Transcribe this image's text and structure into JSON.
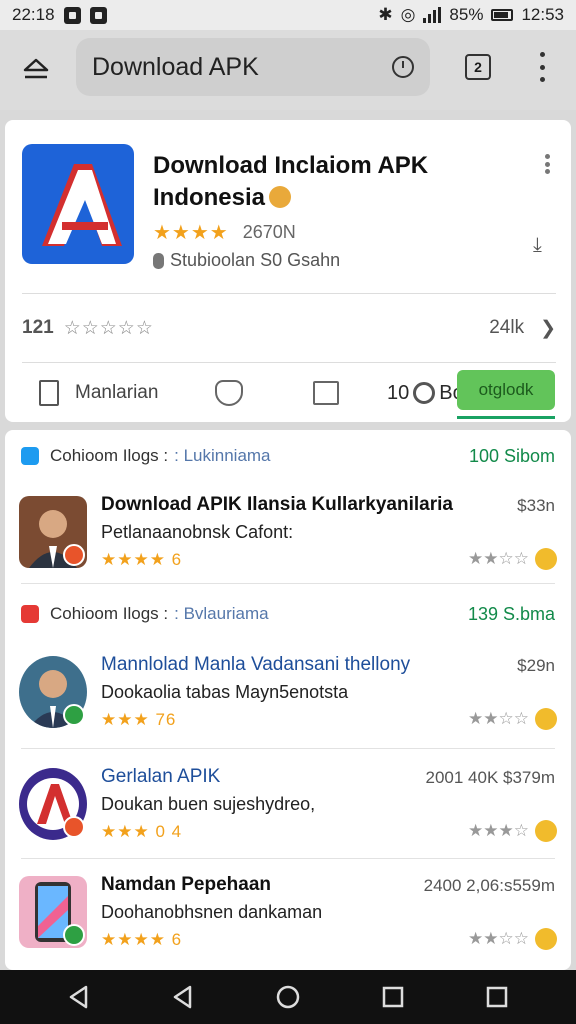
{
  "status": {
    "time": "22:18",
    "battery": "85%",
    "clock": "12:53"
  },
  "search": {
    "query": "Download APK"
  },
  "hero": {
    "title": "Download Inclaiom APK Indonesia",
    "stars": "★★★★",
    "rating_count": "2670N",
    "developer": "Stubioolan S0 Gsahn",
    "review_num": "121",
    "review_stars": "☆☆☆☆☆",
    "download_count": "24lk",
    "action1": "Manlarian",
    "action_num": "10",
    "action_bo": "Bo",
    "action_button": "otglodk"
  },
  "sections": [
    {
      "label": "Cohioom Ilogs :",
      "sub": ": Lukinniama",
      "count": "100 Sibom"
    },
    {
      "label": "Cohioom Ilogs :",
      "sub": ": Bvlauriama",
      "count": "139 S.bma"
    }
  ],
  "items": [
    {
      "title": "Download APIK Ilansia Kullarkyanilaria",
      "sub": "Petlanaanobnsk Cafont:",
      "rating": "★★★★ 6",
      "size": "$33n"
    },
    {
      "title": "Mannlolad Manla Vadansani thellony",
      "sub": "Dookaolia tabas Mayn5enotsta",
      "rating": "★★★ 76",
      "size": "$29n"
    },
    {
      "title": "Gerlalan APIK",
      "sub": "Doukan buen sujeshydreo,",
      "rating": "★★★ 0 4",
      "size": "2001 40K $379m"
    },
    {
      "title": "Namdan Pepehaan",
      "sub": "Doohanobhsnen dankaman",
      "rating": "★★★★ 6",
      "size": "2400 2,06:s559m"
    }
  ],
  "colors": {
    "accent_green": "#62c45a",
    "brand_blue": "#1e63d8",
    "star": "#f2a11c"
  }
}
